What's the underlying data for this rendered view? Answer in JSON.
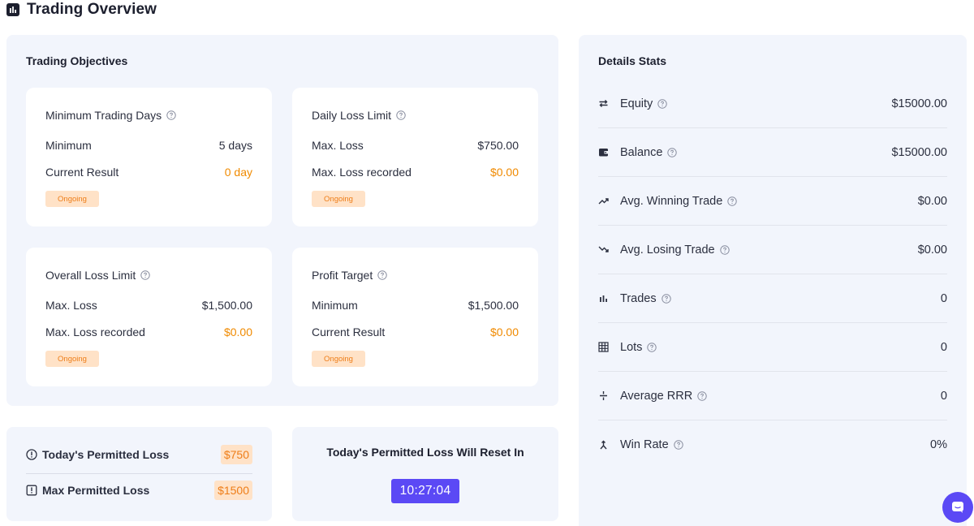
{
  "header": {
    "title": "Trading Overview",
    "icon": "bar-chart-icon"
  },
  "objectives": {
    "title": "Trading Objectives",
    "cards": [
      {
        "title": "Minimum Trading Days",
        "rows": [
          {
            "label": "Minimum",
            "value": "5 days"
          },
          {
            "label": "Current Result",
            "value": "0 day"
          }
        ],
        "status": "Ongoing"
      },
      {
        "title": "Daily Loss Limit",
        "rows": [
          {
            "label": "Max. Loss",
            "value": "$750.00"
          },
          {
            "label": "Max. Loss recorded",
            "value": "$0.00"
          }
        ],
        "status": "Ongoing"
      },
      {
        "title": "Overall Loss Limit",
        "rows": [
          {
            "label": "Max. Loss",
            "value": "$1,500.00"
          },
          {
            "label": "Max. Loss recorded",
            "value": "$0.00"
          }
        ],
        "status": "Ongoing"
      },
      {
        "title": "Profit Target",
        "rows": [
          {
            "label": "Minimum",
            "value": "$1,500.00"
          },
          {
            "label": "Current Result",
            "value": "$0.00"
          }
        ],
        "status": "Ongoing"
      }
    ]
  },
  "limits": {
    "today": {
      "label": "Today's Permitted Loss",
      "value": "$750"
    },
    "max": {
      "label": "Max Permitted Loss",
      "value": "$1500"
    }
  },
  "reset": {
    "title": "Today's Permitted Loss Will Reset In",
    "timer": "10:27:04"
  },
  "details": {
    "title": "Details Stats",
    "stats": [
      {
        "label": "Equity",
        "value": "$15000.00",
        "icon": "swap-arrows-icon"
      },
      {
        "label": "Balance",
        "value": "$15000.00",
        "icon": "wallet-icon"
      },
      {
        "label": "Avg. Winning Trade",
        "value": "$0.00",
        "icon": "trending-up-icon"
      },
      {
        "label": "Avg. Losing Trade",
        "value": "$0.00",
        "icon": "trending-down-icon"
      },
      {
        "label": "Trades",
        "value": "0",
        "icon": "bar-chart-icon"
      },
      {
        "label": "Lots",
        "value": "0",
        "icon": "grid-icon"
      },
      {
        "label": "Average RRR",
        "value": "0",
        "icon": "divide-icon"
      },
      {
        "label": "Win Rate",
        "value": "0%",
        "icon": "merge-icon"
      }
    ]
  },
  "colors": {
    "accent": "#f08a00",
    "badge_bg": "#ffe2c7",
    "timer_bg": "#5b49f5",
    "panel_bg": "#f2f5fc"
  }
}
